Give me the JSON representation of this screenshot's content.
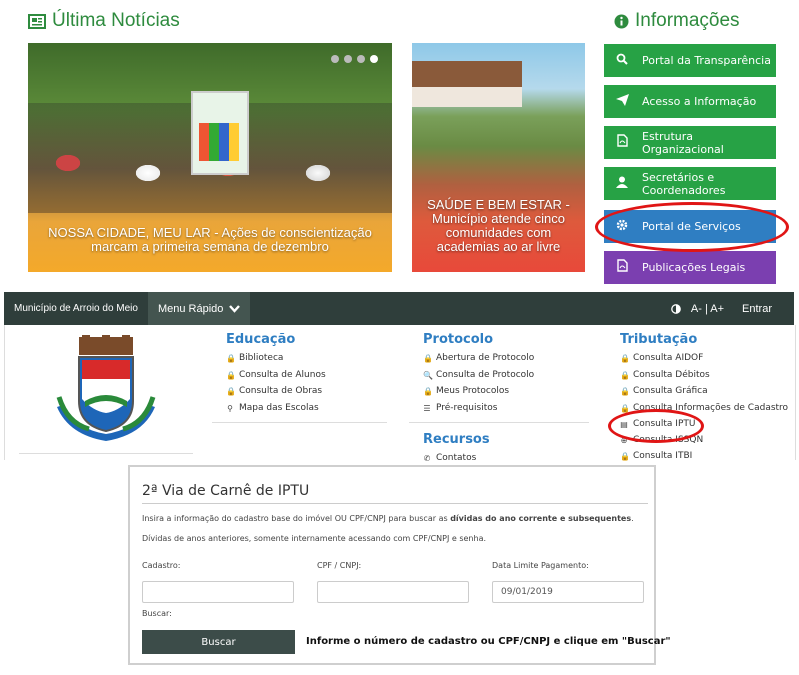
{
  "news": {
    "title": "Última Notícias",
    "main_caption": "NOSSA CIDADE, MEU LAR - Ações de conscientização marcam a primeira semana de dezembro",
    "side_caption": "SAÚDE E BEM ESTAR - Município atende cinco comunidades com academias ao ar livre"
  },
  "info": {
    "title": "Informações",
    "buttons": [
      {
        "label": "Portal da Transparência",
        "icon": "search-icon",
        "color": "#27a245"
      },
      {
        "label": "Acesso a Informação",
        "icon": "paper-plane-icon",
        "color": "#27a245"
      },
      {
        "label": "Estrutura Organizacional",
        "icon": "pdf-file-icon",
        "color": "#27a245"
      },
      {
        "label": "Secretários e Coordenadores",
        "icon": "user-icon",
        "color": "#27a245"
      },
      {
        "label": "Portal de Serviços",
        "icon": "gear-icon",
        "color": "#2f7ec2"
      },
      {
        "label": "Publicações Legais",
        "icon": "pdf-file-icon",
        "color": "#7b3fb0"
      }
    ]
  },
  "nav": {
    "brand": "Município de Arroio do Meio",
    "menu": "Menu Rápido",
    "font_controls": "A- | A+",
    "login": "Entrar"
  },
  "mega": {
    "educacao": {
      "title": "Educação",
      "items": [
        "Biblioteca",
        "Consulta de Alunos",
        "Consulta de Obras",
        "Mapa das Escolas"
      ]
    },
    "protocolo": {
      "title": "Protocolo",
      "items": [
        "Abertura de Protocolo",
        "Consulta de Protocolo",
        "Meus Protocolos",
        "Pré-requisitos"
      ]
    },
    "recursos": {
      "title": "Recursos",
      "items": [
        "Contatos"
      ]
    },
    "tributacao": {
      "title": "Tributação",
      "items": [
        "Consulta AIDOF",
        "Consulta Débitos",
        "Consulta Gráfica",
        "Consulta Informações de Cadastro",
        "Consulta IPTU",
        "Consulta ISSQN",
        "Consulta ITBI"
      ]
    }
  },
  "iptu": {
    "title": "2ª Via de Carnê de IPTU",
    "desc_before": "Insira a informação do cadastro base do imóvel OU CPF/CNPJ para buscar as ",
    "desc_bold": "dívidas do ano corrente e subsequentes",
    "desc_after": ". Dívidas de anos anteriores, somente internamente acessando com CPF/CNPJ e senha.",
    "cadastro_label": "Cadastro:",
    "cpf_label": "CPF / CNPJ:",
    "data_label": "Data Limite Pagamento:",
    "data_value": "09/01/2019",
    "buscar_label": "Buscar:",
    "buscar_button": "Buscar",
    "instruction": "Informe o número de cadastro ou CPF/CNPJ e clique em \"Buscar\""
  }
}
